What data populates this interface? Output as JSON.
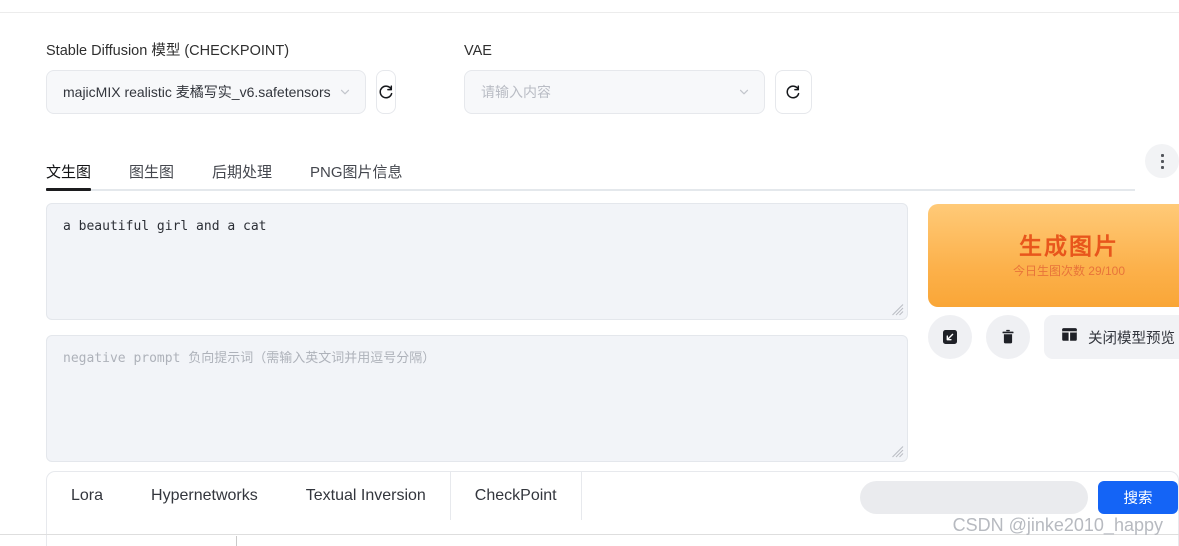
{
  "model_section": {
    "checkpoint": {
      "label": "Stable Diffusion 模型 (CHECKPOINT)",
      "value": "majicMIX realistic 麦橘写实_v6.safetensors",
      "refresh_icon": "refresh-icon",
      "chevron_icon": "chevron-down-icon"
    },
    "vae": {
      "label": "VAE",
      "value": "",
      "placeholder": "请输入内容",
      "refresh_icon": "refresh-icon",
      "chevron_icon": "chevron-down-icon"
    }
  },
  "main_tabs": {
    "items": [
      {
        "label": "文生图",
        "active": true
      },
      {
        "label": "图生图",
        "active": false
      },
      {
        "label": "后期处理",
        "active": false
      },
      {
        "label": "PNG图片信息",
        "active": false
      }
    ],
    "more_icon": "more-vertical-icon"
  },
  "prompts": {
    "positive": {
      "value": "a beautiful girl and a cat",
      "placeholder": ""
    },
    "negative": {
      "value": "",
      "placeholder": "negative prompt 负向提示词（需输入英文词并用逗号分隔）"
    }
  },
  "generate": {
    "title": "生成图片",
    "subtitle": "今日生图次数 29/100",
    "gradient_from": "#ffca78",
    "gradient_to": "#f9a637",
    "title_color": "#e8561c"
  },
  "actions": {
    "import_params_icon": "arrow-down-left-square-icon",
    "delete_icon": "trash-icon",
    "preview_toggle": {
      "label": "关闭模型预览",
      "icon": "layout-panel-icon"
    }
  },
  "model_browser": {
    "tabs": [
      {
        "label": "Lora",
        "active": false
      },
      {
        "label": "Hypernetworks",
        "active": false
      },
      {
        "label": "Textual Inversion",
        "active": false
      },
      {
        "label": "CheckPoint",
        "active": true
      }
    ],
    "search": {
      "value": "",
      "placeholder": "",
      "button_label": "搜索",
      "button_color": "#1464f6"
    }
  },
  "watermark": {
    "text": "CSDN @jinke2010_happy"
  }
}
